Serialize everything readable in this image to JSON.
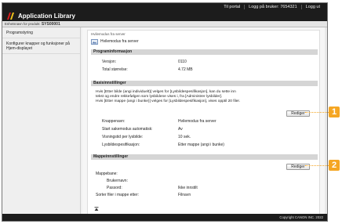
{
  "header": {
    "app_title": "Application Library",
    "links": [
      "Til portal",
      "Logg på bruker: 7654321",
      "Logg ut"
    ]
  },
  "status": {
    "prefix": "Enhetsnavn for produkt: ",
    "device": "SYS00001"
  },
  "sidebar": {
    "items": [
      {
        "label": "Programstyring"
      },
      {
        "label": "Konfigurer knapper og funksjoner på Hjem-displayet"
      }
    ]
  },
  "main": {
    "breadcrumb": "Hvilemodus fra server",
    "page_title": "Hvilemodus fra server",
    "program_info": {
      "heading": "Programinformasjon",
      "rows": [
        {
          "label": "Versjon:",
          "value": "0110"
        },
        {
          "label": "Total størrelse:",
          "value": "4.72 MB"
        }
      ]
    },
    "basic": {
      "heading": "Basisinnstillinger",
      "text_lines": [
        "Hvis [Etter bilde (angi individuelt)] velges for [Lysbildespesifikasjon], kan du sette inn",
        "tekst og endre rekkefølgen som lysbildene vises i, fra [Administrer lysbilder].",
        "Hvis [Etter mappe (angi i bunke)] velges for [Lysbildespesifikasjon], vises opptil 20 filer."
      ],
      "edit_label": "Rediger",
      "rows": [
        {
          "label": "Knappenavn:",
          "value": "Hvilemodus fra server"
        },
        {
          "label": "Start sakemodus automatisk:",
          "value": "Av"
        },
        {
          "label": "Visningstid per lysbilde:",
          "value": "10 sek."
        },
        {
          "label": "Lysbildespesifikasjon:",
          "value": "Etter mappe (angi i bunke)"
        }
      ]
    },
    "folder": {
      "heading": "Mappeinnstillinger",
      "edit_label": "Rediger",
      "rows": [
        {
          "label": "Mappebane:",
          "value": ""
        },
        {
          "label": "Brukernavn:",
          "value": ""
        },
        {
          "label": "Passord:",
          "value": "Ikke innstilt"
        },
        {
          "label": "Sorter filer i mappe etter:",
          "value": "Filnavn"
        }
      ]
    }
  },
  "callouts": [
    "1",
    "2"
  ],
  "footer": "Copyright CANON INC. 2022",
  "colors": {
    "header_bg": "#1c1c1c",
    "callout": "#f5a623",
    "section_bg": "#d5d5d5",
    "logo_red": "#d91d1d",
    "logo_yellow": "#f2c21a"
  }
}
